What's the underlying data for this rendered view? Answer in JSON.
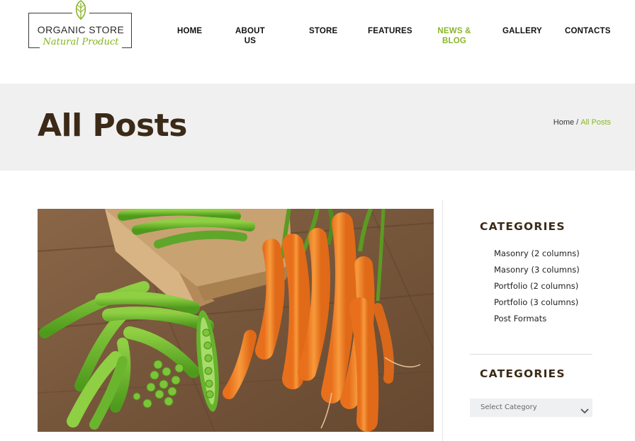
{
  "logo": {
    "title": "ORGANIC STORE",
    "subtitle": "Natural Product"
  },
  "nav": {
    "items": [
      {
        "label": "HOME"
      },
      {
        "label": "ABOUT US"
      },
      {
        "label": "STORE"
      },
      {
        "label": "FEATURES"
      },
      {
        "label": "NEWS &\nBLOG"
      },
      {
        "label": "GALLERY"
      },
      {
        "label": "CONTACTS"
      }
    ],
    "active_label_line1": "NEWS &",
    "active_label_line2": "BLOG"
  },
  "page": {
    "title": "All Posts"
  },
  "breadcrumb": {
    "home": "Home",
    "separator": "/",
    "current": "All Posts"
  },
  "sidebar": {
    "categories_title": "CATEGORIES",
    "categories": [
      "Masonry (2 columns)",
      "Masonry (3 columns)",
      "Portfolio (2 columns)",
      "Portfolio (3 columns)",
      "Post Formats"
    ],
    "dropdown_title": "CATEGORIES",
    "dropdown_value": "Select Category"
  },
  "colors": {
    "accent": "#8ab62a",
    "heading": "#3b2a17",
    "band": "#f0f0f0"
  }
}
